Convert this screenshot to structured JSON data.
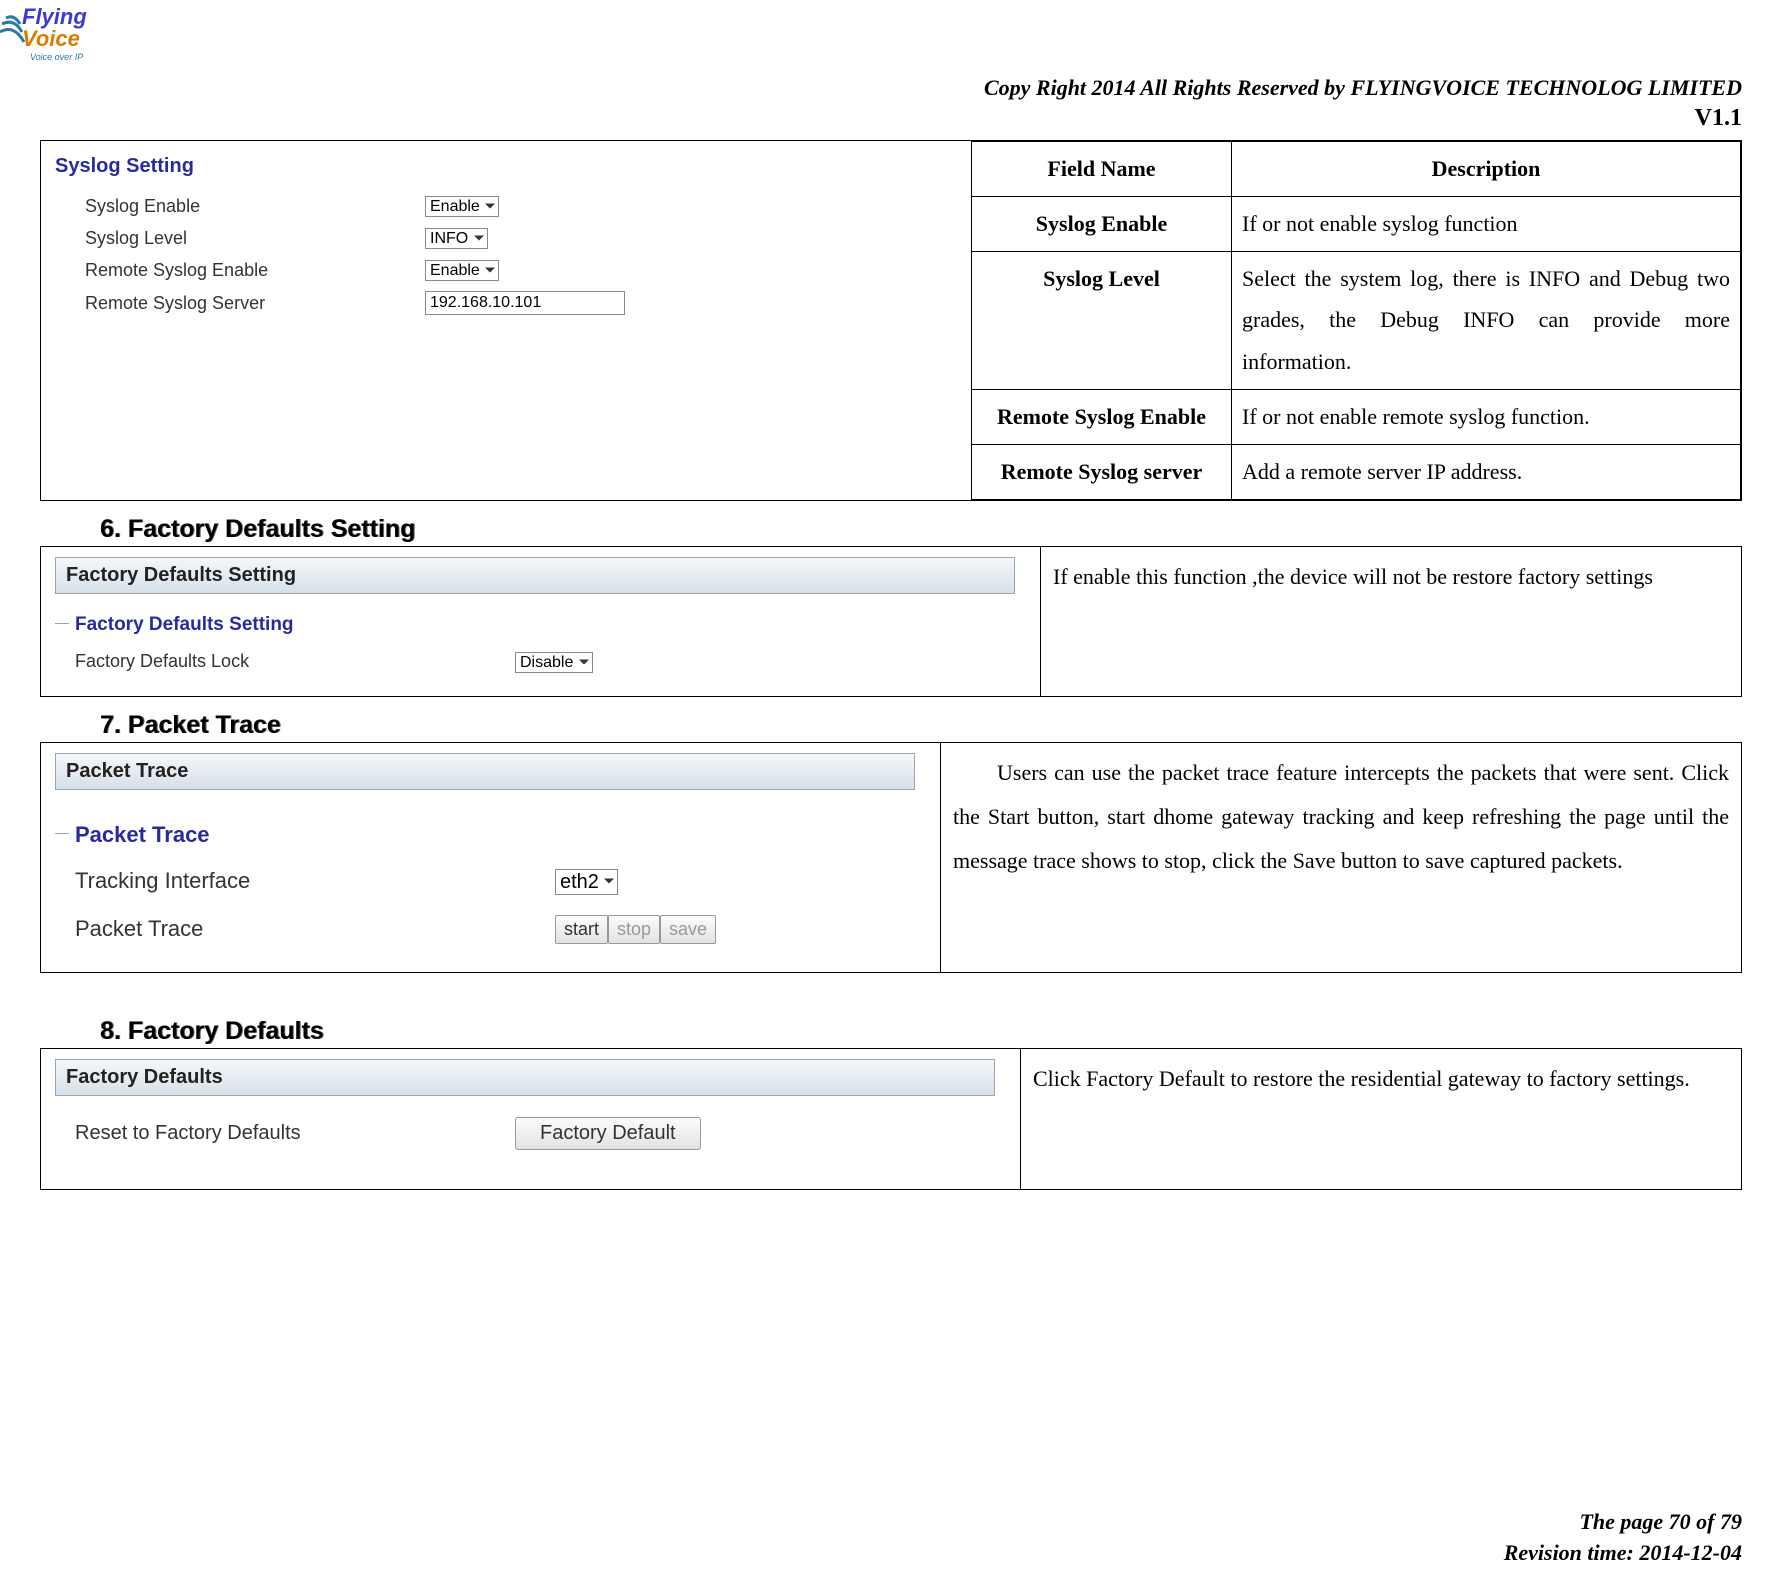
{
  "header": {
    "copyright": "Copy Right 2014 All Rights Reserved by FLYINGVOICE TECHNOLOG LIMITED",
    "version": "V1.1"
  },
  "logo": {
    "line1": "Flying",
    "line2": "Voice",
    "tagline": "Voice over IP"
  },
  "syslog_panel": {
    "title": "Syslog Setting",
    "rows": {
      "enable_label": "Syslog Enable",
      "enable_value": "Enable",
      "level_label": "Syslog Level",
      "level_value": "INFO",
      "remote_enable_label": "Remote Syslog Enable",
      "remote_enable_value": "Enable",
      "remote_server_label": "Remote Syslog Server",
      "remote_server_value": "192.168.10.101"
    }
  },
  "syslog_table": {
    "header_field": "Field Name",
    "header_desc": "Description",
    "rows": [
      {
        "field": "Syslog Enable",
        "desc": "If or not enable syslog function"
      },
      {
        "field": "Syslog Level",
        "desc": "Select the system log, there is INFO and Debug two grades, the Debug INFO can provide more information."
      },
      {
        "field": "Remote Syslog Enable",
        "desc": "If or not enable remote syslog function."
      },
      {
        "field": "Remote Syslog server",
        "desc": "Add a remote server IP address."
      }
    ]
  },
  "section6": {
    "heading": "6.  Factory Defaults Setting",
    "panel_title": "Factory Defaults Setting",
    "section_title": "Factory Defaults Setting",
    "lock_label": "Factory Defaults Lock",
    "lock_value": "Disable",
    "desc": "If enable this function ,the device will not be restore factory settings"
  },
  "section7": {
    "heading": "7.  Packet Trace",
    "panel_title": "Packet Trace",
    "section_title": "Packet Trace",
    "iface_label": "Tracking Interface",
    "iface_value": "eth2",
    "trace_label": "Packet Trace",
    "btn_start": "start",
    "btn_stop": "stop",
    "btn_save": "save",
    "desc": "Users can use the packet trace feature intercepts the packets that were sent. Click the Start button, start dhome gateway tracking and keep refreshing the page until the message trace shows to stop, click the Save button to save captured packets."
  },
  "section8": {
    "heading": "8.  Factory Defaults",
    "panel_title": "Factory Defaults",
    "reset_label": "Reset to Factory Defaults",
    "btn_reset": "Factory Default",
    "desc": "Click Factory Default to restore the residential gateway to factory settings."
  },
  "footer": {
    "page": "The page 70 of 79",
    "revision": "Revision time: 2014-12-04"
  }
}
